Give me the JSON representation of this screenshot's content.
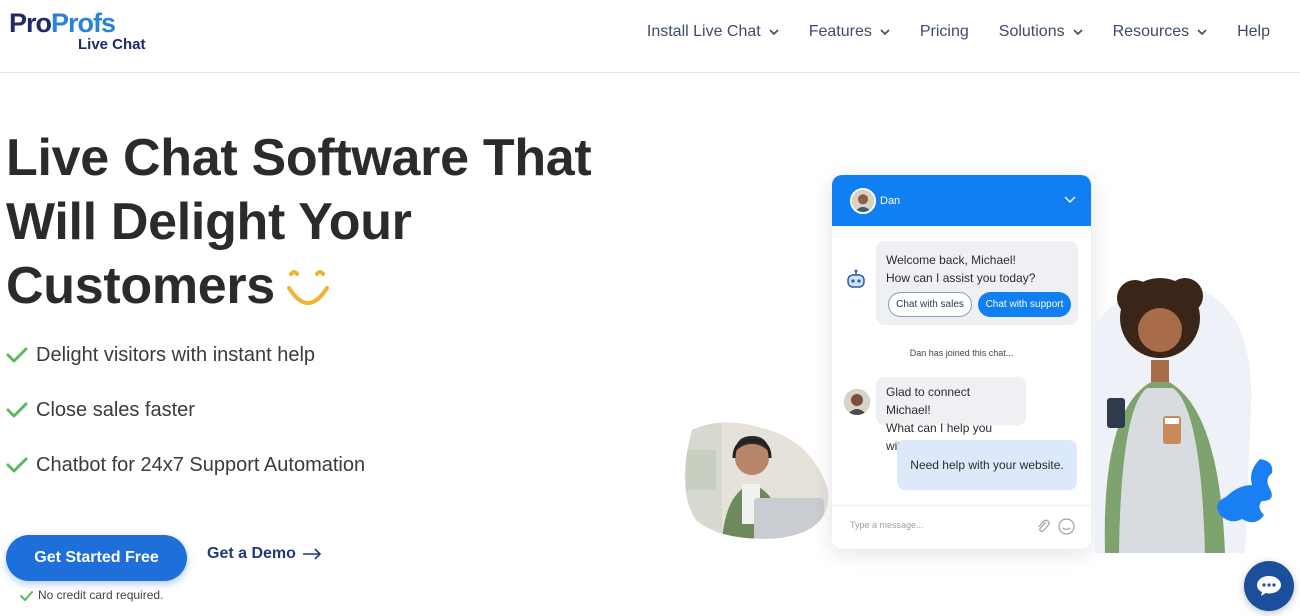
{
  "brand": {
    "logo_part1": "Pro",
    "logo_part2": "Profs",
    "logo_sub": "Live Chat",
    "colors": {
      "navy": "#1f2a6b",
      "blue": "#2a83d8",
      "primary": "#1f6fdb",
      "chat_blue": "#0f7ff2",
      "check_green": "#5cb85c"
    }
  },
  "nav": {
    "items": [
      {
        "label": "Install Live Chat",
        "has_dropdown": true
      },
      {
        "label": "Features",
        "has_dropdown": true
      },
      {
        "label": "Pricing",
        "has_dropdown": false
      },
      {
        "label": "Solutions",
        "has_dropdown": true
      },
      {
        "label": "Resources",
        "has_dropdown": true
      },
      {
        "label": "Help",
        "has_dropdown": false
      }
    ]
  },
  "hero": {
    "headline_line1": "Live Chat Software That",
    "headline_line2": "Will Delight Your",
    "headline_line3": "Customers",
    "bullets": [
      "Delight visitors with instant help",
      "Close sales faster",
      "Chatbot for 24x7 Support Automation"
    ],
    "cta_primary": "Get Started Free",
    "cta_secondary": "Get a Demo",
    "note": "No credit card required."
  },
  "chat_widget": {
    "agent_name": "Dan",
    "bot_message_line1": "Welcome back, Michael!",
    "bot_message_line2": "How can I assist you today?",
    "quick_reply_1": "Chat with sales",
    "quick_reply_2": "Chat with support",
    "system_message": "Dan has joined this chat...",
    "agent_message_line1": "Glad to connect Michael!",
    "agent_message_line2": "What can I help you with?",
    "user_message": "Need help with your website.",
    "input_placeholder": "Type a message..."
  }
}
